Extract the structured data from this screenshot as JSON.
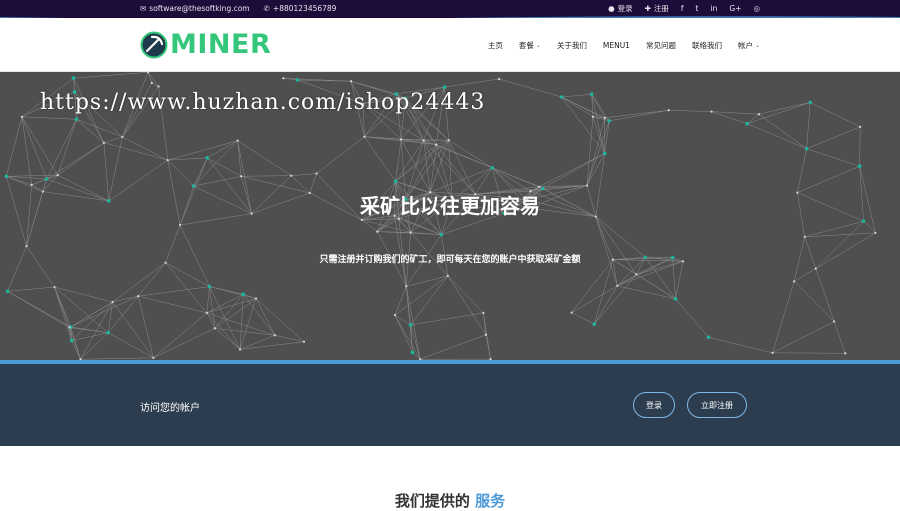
{
  "topbar": {
    "email": "software@thesoftking.com",
    "phone": "+880123456789",
    "login": "登录",
    "register": "注册",
    "social": [
      "facebook-icon",
      "twitter-icon",
      "linkedin-icon",
      "google-plus-icon",
      "instagram-icon"
    ],
    "social_glyphs": [
      "f",
      "t",
      "in",
      "G+",
      "◎"
    ]
  },
  "header": {
    "logo_text": "MINER",
    "nav": [
      {
        "label": "主页",
        "dropdown": false
      },
      {
        "label": "套餐",
        "dropdown": true
      },
      {
        "label": "关于我们",
        "dropdown": false
      },
      {
        "label": "MENU1",
        "dropdown": false
      },
      {
        "label": "常见问题",
        "dropdown": false
      },
      {
        "label": "联络我们",
        "dropdown": false
      },
      {
        "label": "帐户",
        "dropdown": true
      }
    ]
  },
  "hero": {
    "watermark": "https://www.huzhan.com/ishop24443",
    "title": "采矿比以往更加容易",
    "subtitle": "只需注册并订购我们的矿工，即可每天在您的账户中获取采矿金额"
  },
  "account": {
    "label": "访问您的帐户",
    "login_button": "登录",
    "register_button": "立即注册"
  },
  "services": {
    "prefix": "我们提供的",
    "accent": "服务"
  },
  "colors": {
    "topbar_bg": "#1d0b3a",
    "logo_green": "#34c77b",
    "hero_bg": "#4f4f4f",
    "node_teal": "#1fb59a",
    "accent_blue": "#4d9ad8",
    "account_bg": "#2c3d4f"
  }
}
